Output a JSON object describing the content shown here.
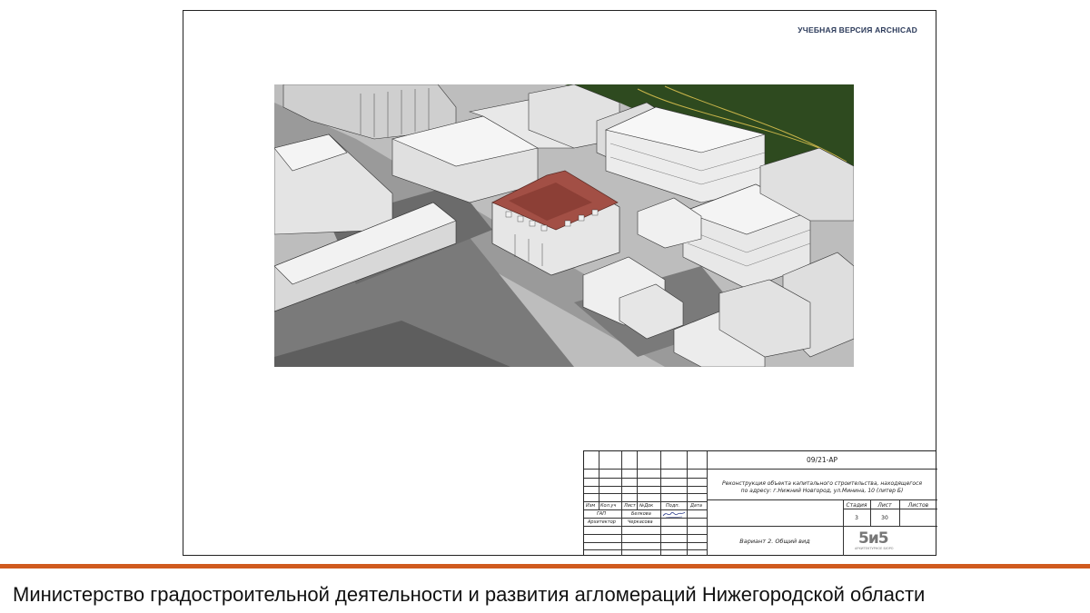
{
  "sheet": {
    "watermark": "УЧЕБНАЯ ВЕРСИЯ ARCHICAD"
  },
  "render": {
    "description_icon": "aerial-3d-view-image",
    "colors": {
      "roof_highlight": "#a24f45",
      "ground": "#bdbdbd",
      "shadow": "#6b6b6b",
      "grass": "#2e4a1f"
    }
  },
  "title_block": {
    "doc_code": "09/21-АР",
    "project_name_line1": "Реконструкция объекта капитального строительства, находящегося",
    "project_name_line2": "по адресу: г.Нижний Новгород, ул.Минина, 10 (литер Б)",
    "col_izm": "Изм",
    "col_kol_uch": "Кол.уч",
    "col_list": "Лист",
    "col_ndok": "№Док",
    "col_podp": "Подп.",
    "col_data": "Дата",
    "row_gap": "ГАП",
    "row_gap_name": "Белкова",
    "row_arch": "Архитектор",
    "row_arch_name": "Черкасова",
    "stage_label": "Стадия",
    "sheet_label": "Лист",
    "sheets_label": "Листов",
    "stage_value": "3",
    "sheet_value": "30",
    "sheets_value": "",
    "drawing_title": "Вариант 2. Общий вид",
    "firm_logo": "5и5",
    "firm_caption": "АРХИТЕКТУРНОЕ БЮРО"
  },
  "footer": {
    "accent_color": "#d05a1e",
    "text": "Министерство градостроительной деятельности и развития агломераций Нижегородской области"
  }
}
